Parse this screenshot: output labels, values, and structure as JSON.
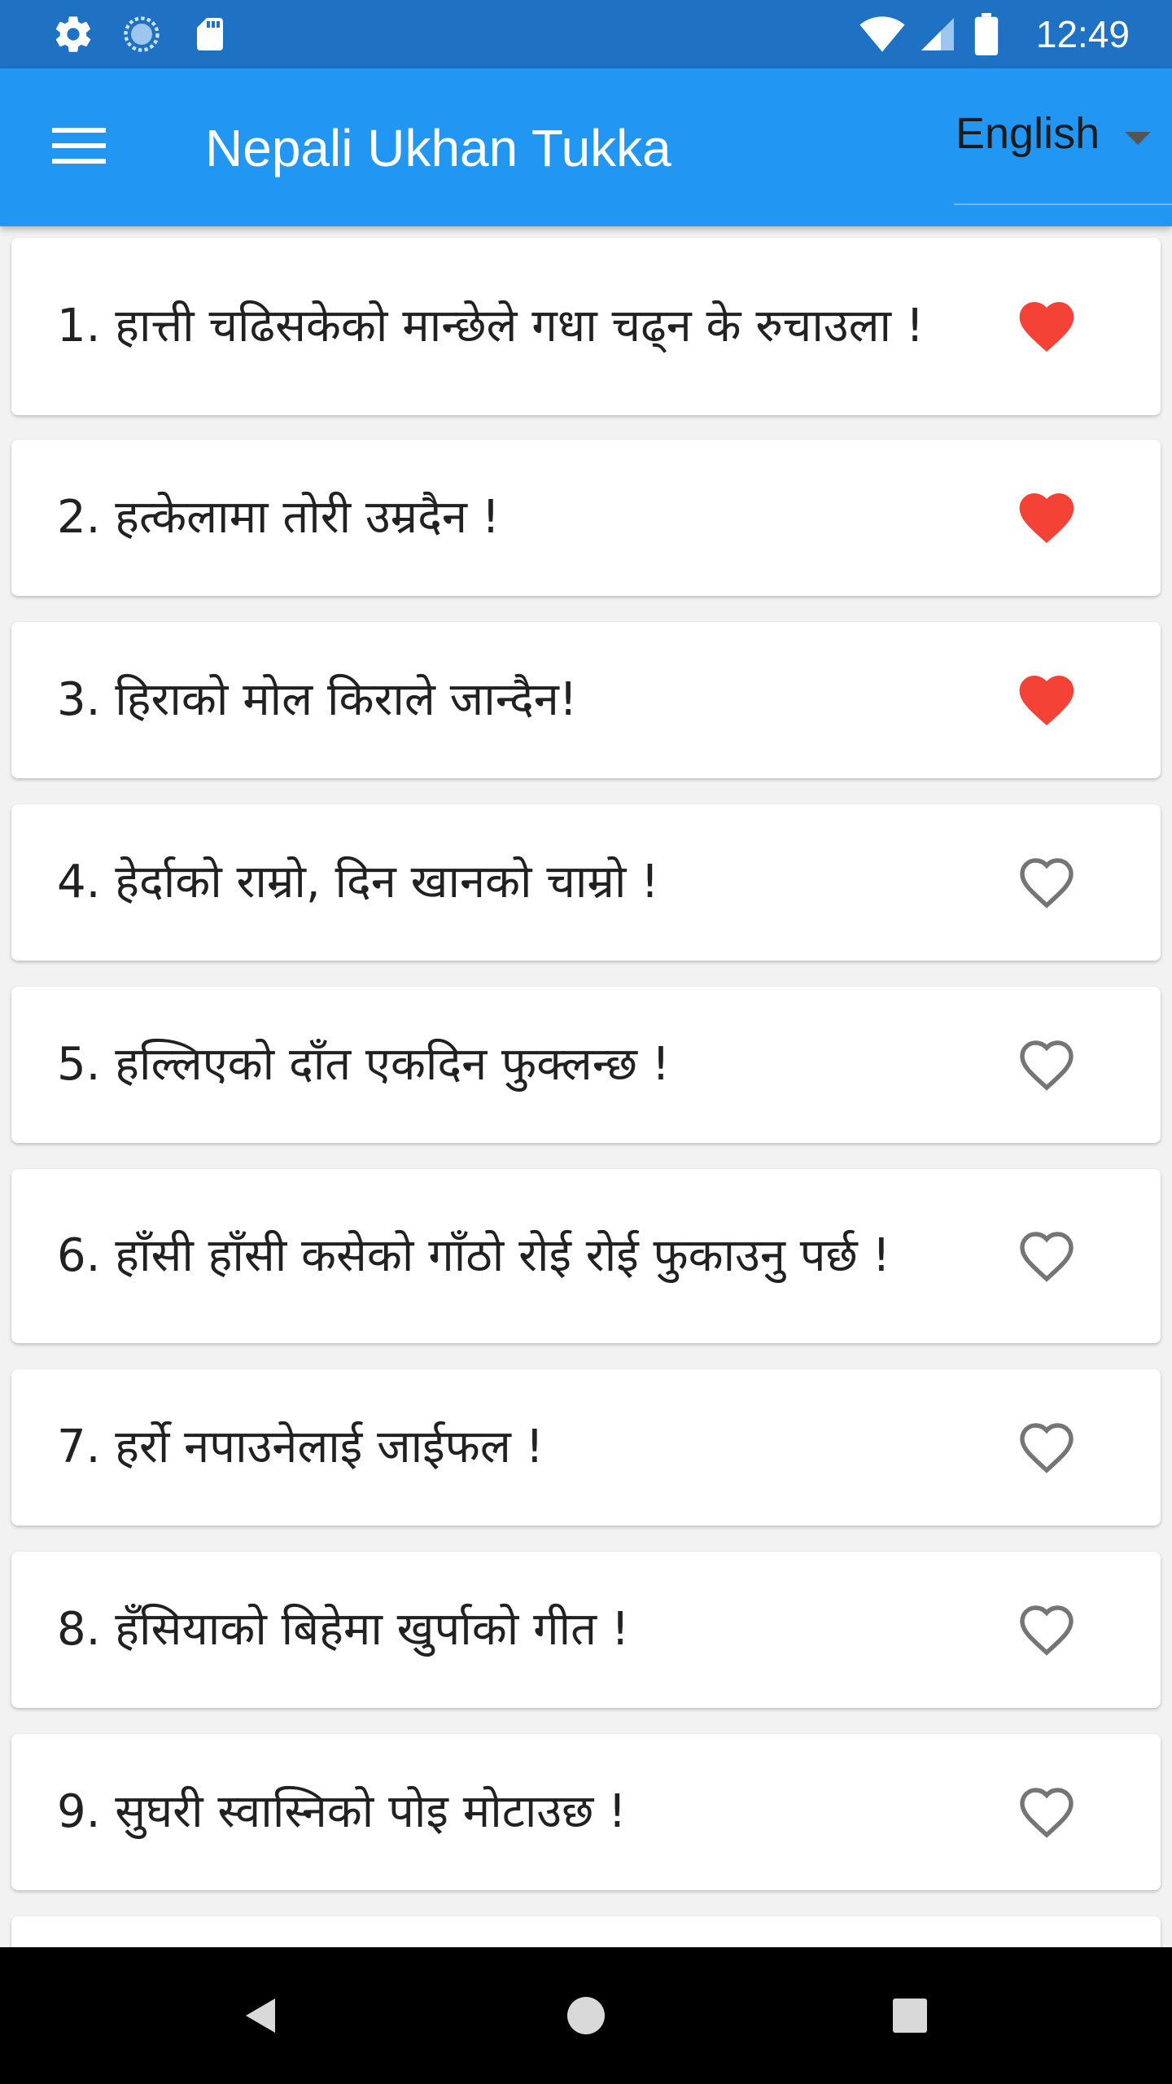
{
  "status_bar": {
    "time": "12:49",
    "icons": [
      "settings-icon",
      "sync-icon",
      "sd-card-icon",
      "wifi-icon",
      "signal-icon",
      "battery-icon"
    ]
  },
  "app_bar": {
    "title": "Nepali Ukhan Tukka",
    "language": "English",
    "color": "#2196f3"
  },
  "colors": {
    "heart_filled": "#f44336",
    "heart_outline": "#757575"
  },
  "items": [
    {
      "text": "1. हात्ती चढिसकेको मान्छेले गधा चढ्न के रुचाउला !",
      "favorite": true
    },
    {
      "text": "2. हत्केलामा तोरी उम्रदैन !",
      "favorite": true
    },
    {
      "text": "3. हिराको मोल किराले जान्दैन!",
      "favorite": true
    },
    {
      "text": "4. हेर्दाको राम्रो, दिन खानको चाम्रो !",
      "favorite": false
    },
    {
      "text": "5. हल्लिएको दाँत एकदिन फुक्लन्छ !",
      "favorite": false
    },
    {
      "text": "6. हाँसी हाँसी कसेको गाँठो रोई रोई फुकाउनु पर्छ !",
      "favorite": false
    },
    {
      "text": "7. हर्रो नपाउनेलाई जाईफल !",
      "favorite": false
    },
    {
      "text": "8. हँसियाको बिहेमा खुर्पाको गीत !",
      "favorite": false
    },
    {
      "text": "9. सुघरी स्वास्निको पोइ मोटाउछ !",
      "favorite": false
    }
  ]
}
